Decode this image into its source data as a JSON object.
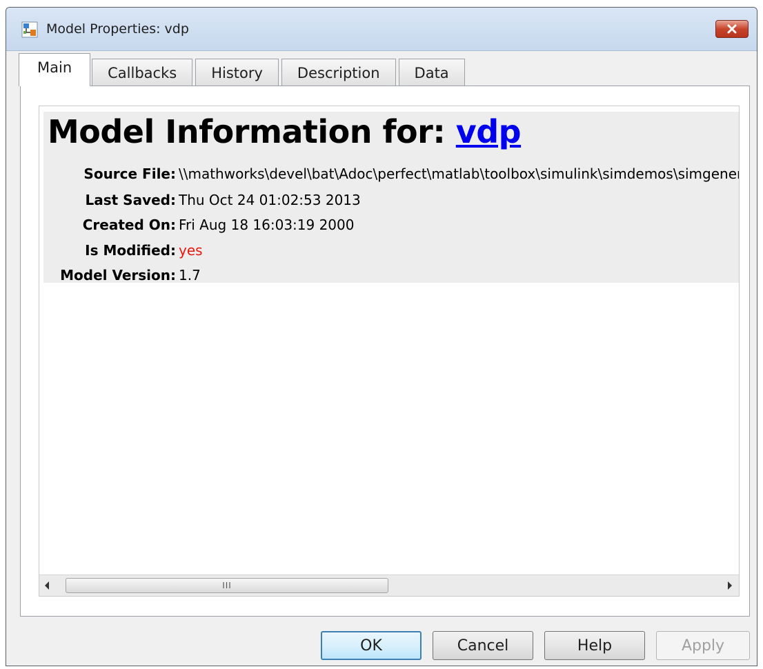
{
  "window": {
    "title": "Model Properties: vdp",
    "title_icon": "simulink-model-icon",
    "close_icon": "close-x-icon"
  },
  "tabs": [
    {
      "label": "Main",
      "active": true
    },
    {
      "label": "Callbacks",
      "active": false
    },
    {
      "label": "History",
      "active": false
    },
    {
      "label": "Description",
      "active": false
    },
    {
      "label": "Data",
      "active": false
    }
  ],
  "info": {
    "heading": "Model Information for: ",
    "model_link": "vdp",
    "rows": [
      {
        "label": "Source File:",
        "value": "\\\\mathworks\\devel\\bat\\Adoc\\perfect\\matlab\\toolbox\\simulink\\simdemos\\simgeneral\\vdp.mdl"
      },
      {
        "label": "Last Saved:",
        "value": "Thu Oct 24 01:02:53 2013"
      },
      {
        "label": "Created On:",
        "value": "Fri Aug 18 16:03:19 2000"
      },
      {
        "label": "Is Modified:",
        "value": "yes"
      },
      {
        "label": "Model Version:",
        "value": "1.7"
      }
    ]
  },
  "scrollbar": {
    "grip": "III"
  },
  "buttons": {
    "ok": "OK",
    "cancel": "Cancel",
    "help": "Help",
    "apply": "Apply"
  },
  "colors": {
    "link": "#0000ee",
    "modified": "#e8170b",
    "info_background": "#ededed",
    "default_button_border": "#3c7fb1"
  }
}
